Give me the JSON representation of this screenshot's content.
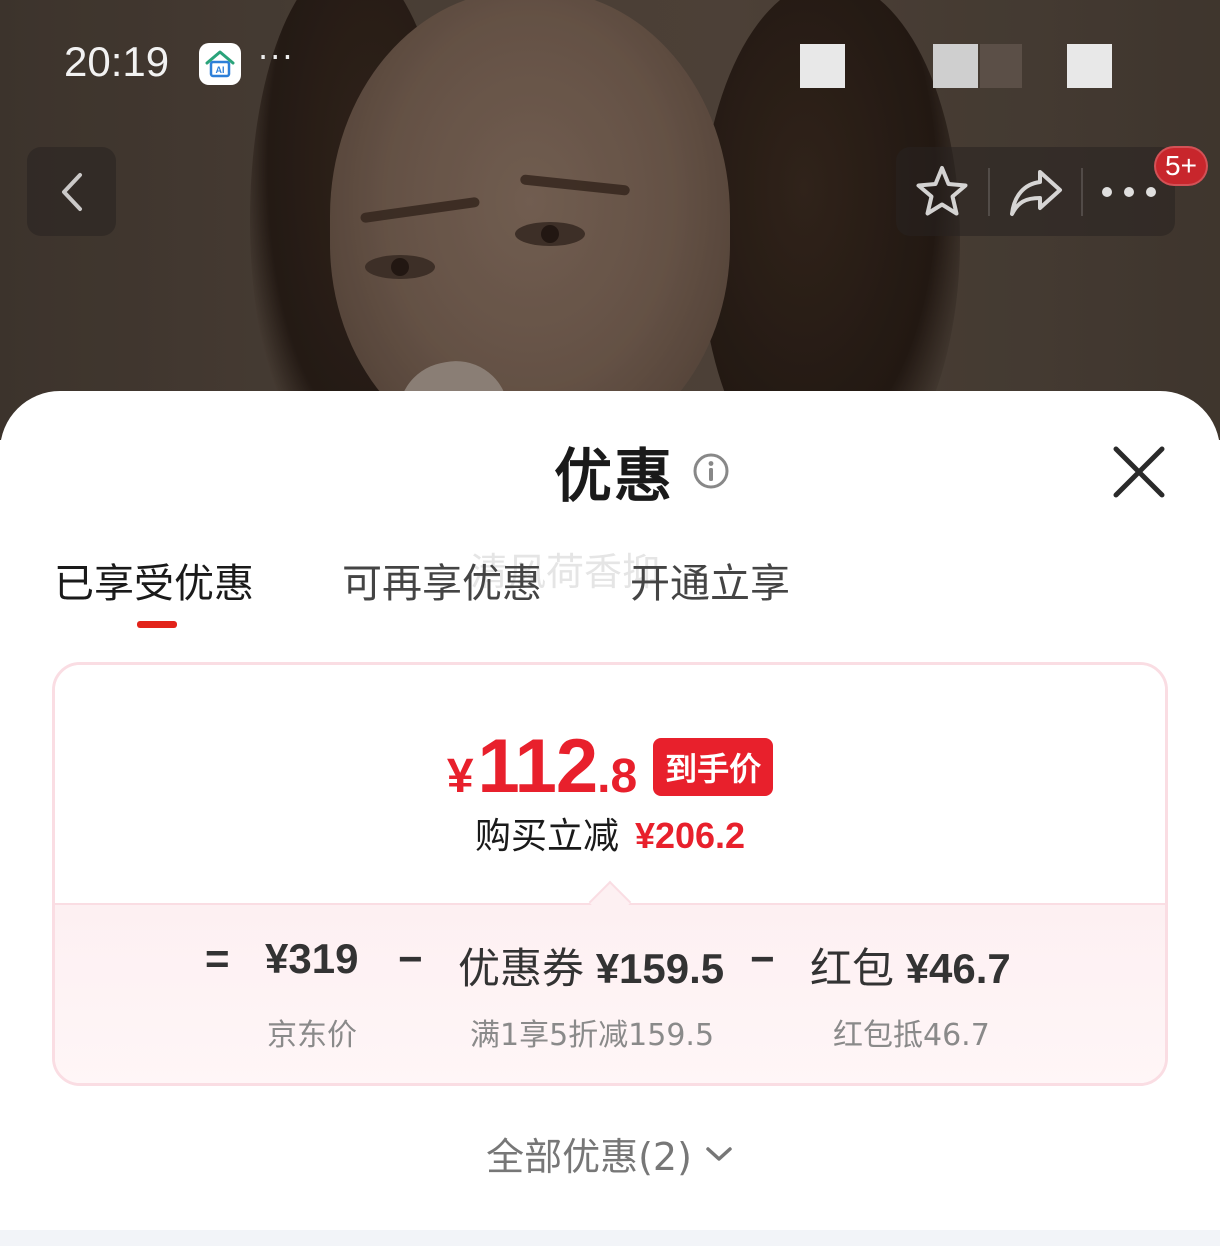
{
  "status_bar": {
    "time": "20:19",
    "app_icon": "ai-home-app-icon",
    "dots": "···"
  },
  "nav": {
    "back_icon": "chevron-left-icon",
    "favorite_icon": "star-outline-icon",
    "share_icon": "share-arrow-icon",
    "more_icon": "more-dots-icon",
    "badge": "5+"
  },
  "sheet": {
    "title": "优惠",
    "info_icon": "info-circle-icon",
    "close_icon": "close-icon",
    "tabs": [
      {
        "label": "已享受优惠",
        "active": true
      },
      {
        "label": "可再享优惠",
        "active": false
      },
      {
        "label": "开通立享",
        "active": false
      }
    ],
    "watermark": "清风荷香抑"
  },
  "deal_card": {
    "final_price": {
      "currency": "¥",
      "integer": "112",
      "decimal": ".8"
    },
    "price_tag": "到手价",
    "save_label": "购买立减",
    "save_amount": "¥206.2",
    "formula": {
      "equals": "=",
      "base_price": "¥319",
      "base_label": "京东价",
      "minus_1": "−",
      "coupon_name": "优惠券",
      "coupon_amount": "¥159.5",
      "coupon_desc": "满1享5折减159.5",
      "minus_2": "−",
      "redpacket_name": "红包",
      "redpacket_amount": "¥46.7",
      "redpacket_desc": "红包抵46.7"
    }
  },
  "footer": {
    "all_offers": "全部优惠(2)",
    "chevron_icon": "chevron-down-icon"
  },
  "colors": {
    "accent_red": "#e8202c",
    "card_border": "#fadde3",
    "card_tint": "#fdf0f2"
  }
}
